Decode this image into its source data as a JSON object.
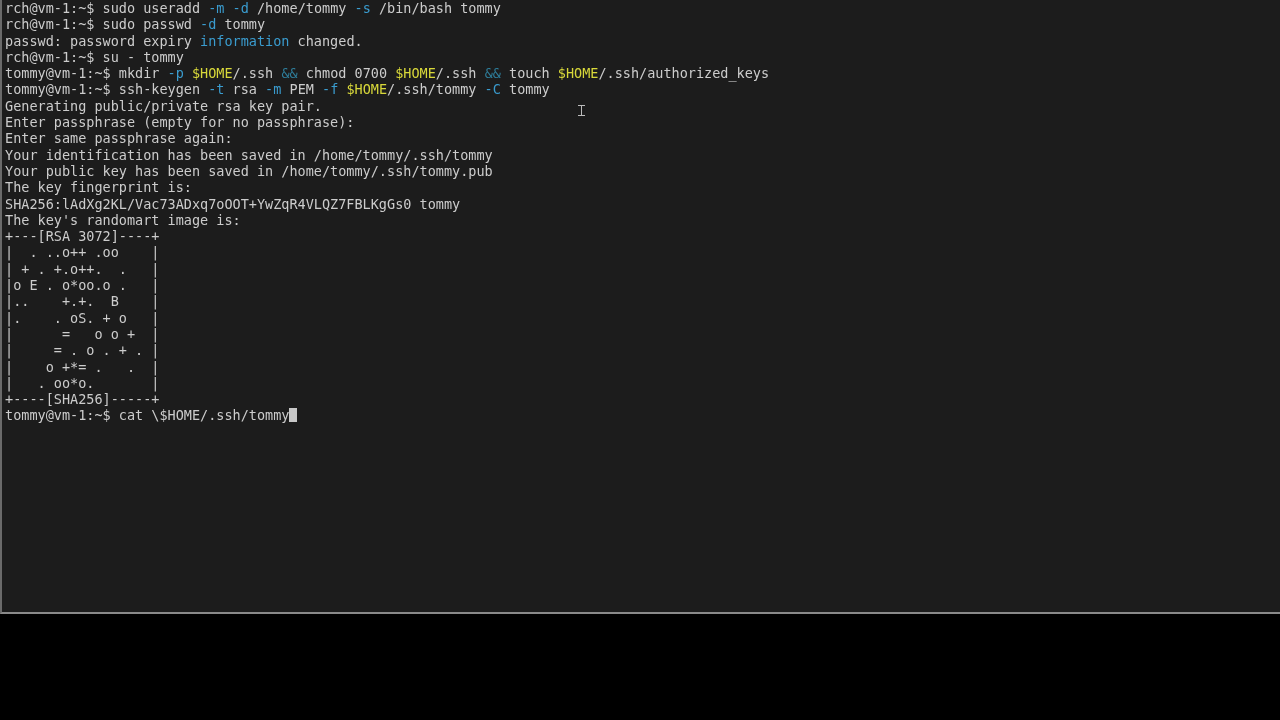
{
  "terminal": {
    "cursor": true,
    "lines": [
      {
        "segments": [
          {
            "kind": "plain",
            "text": "rch@vm-1:~$ sudo useradd "
          },
          {
            "kind": "flag",
            "text": "-m"
          },
          {
            "kind": "flag",
            "text": " -d"
          },
          {
            "kind": "plain",
            "text": " /home/tommy "
          },
          {
            "kind": "flag",
            "text": "-s"
          },
          {
            "kind": "plain",
            "text": " /bin/bash tommy"
          }
        ]
      },
      {
        "segments": [
          {
            "kind": "plain",
            "text": "rch@vm-1:~$ sudo passwd "
          },
          {
            "kind": "flag",
            "text": "-d"
          },
          {
            "kind": "plain",
            "text": " tommy"
          }
        ]
      },
      {
        "segments": [
          {
            "kind": "plain",
            "text": "passwd: password expiry "
          },
          {
            "kind": "flag",
            "text": "information"
          },
          {
            "kind": "plain",
            "text": " changed."
          }
        ]
      },
      {
        "segments": [
          {
            "kind": "plain",
            "text": "rch@vm-1:~$ su - tommy"
          }
        ]
      },
      {
        "segments": [
          {
            "kind": "plain",
            "text": "tommy@vm-1:~$ mkdir "
          },
          {
            "kind": "flag",
            "text": "-p"
          },
          {
            "kind": "var",
            "text": " $HOME"
          },
          {
            "kind": "plain",
            "text": "/.ssh "
          },
          {
            "kind": "op",
            "text": "&&"
          },
          {
            "kind": "plain",
            "text": " chmod 0700 "
          },
          {
            "kind": "var",
            "text": "$HOME"
          },
          {
            "kind": "plain",
            "text": "/.ssh "
          },
          {
            "kind": "op",
            "text": "&&"
          },
          {
            "kind": "plain",
            "text": " touch "
          },
          {
            "kind": "var",
            "text": "$HOME"
          },
          {
            "kind": "plain",
            "text": "/.ssh/authorized_keys"
          }
        ]
      },
      {
        "segments": [
          {
            "kind": "plain",
            "text": "tommy@vm-1:~$ ssh-keygen "
          },
          {
            "kind": "flag",
            "text": "-t"
          },
          {
            "kind": "plain",
            "text": " rsa "
          },
          {
            "kind": "flag",
            "text": "-m"
          },
          {
            "kind": "plain",
            "text": " PEM "
          },
          {
            "kind": "flag",
            "text": "-f"
          },
          {
            "kind": "var",
            "text": " $HOME"
          },
          {
            "kind": "plain",
            "text": "/.ssh/tommy "
          },
          {
            "kind": "flag",
            "text": "-C"
          },
          {
            "kind": "plain",
            "text": " tommy"
          }
        ]
      },
      {
        "segments": [
          {
            "kind": "plain",
            "text": "Generating public/private rsa key pair."
          }
        ]
      },
      {
        "segments": [
          {
            "kind": "plain",
            "text": "Enter passphrase (empty for no passphrase):"
          }
        ]
      },
      {
        "segments": [
          {
            "kind": "plain",
            "text": "Enter same passphrase again:"
          }
        ]
      },
      {
        "segments": [
          {
            "kind": "plain",
            "text": "Your identification has been saved in /home/tommy/.ssh/tommy"
          }
        ]
      },
      {
        "segments": [
          {
            "kind": "plain",
            "text": "Your public key has been saved in /home/tommy/.ssh/tommy.pub"
          }
        ]
      },
      {
        "segments": [
          {
            "kind": "plain",
            "text": "The key fingerprint is:"
          }
        ]
      },
      {
        "segments": [
          {
            "kind": "plain",
            "text": "SHA256:lAdXg2KL/Vac73ADxq7oOOT+YwZqR4VLQZ7FBLKgGs0 tommy"
          }
        ]
      },
      {
        "segments": [
          {
            "kind": "plain",
            "text": "The key's randomart image is:"
          }
        ]
      },
      {
        "segments": [
          {
            "kind": "plain",
            "text": "+---[RSA 3072]----+"
          }
        ]
      },
      {
        "segments": [
          {
            "kind": "plain",
            "text": "|  . ..o++ .oo    |"
          }
        ]
      },
      {
        "segments": [
          {
            "kind": "plain",
            "text": "| + . +.o++.  .   |"
          }
        ]
      },
      {
        "segments": [
          {
            "kind": "plain",
            "text": "|o E . o*oo.o .   |"
          }
        ]
      },
      {
        "segments": [
          {
            "kind": "plain",
            "text": "|..    +.+.  B    |"
          }
        ]
      },
      {
        "segments": [
          {
            "kind": "plain",
            "text": "|.    . oS. + o   |"
          }
        ]
      },
      {
        "segments": [
          {
            "kind": "plain",
            "text": "|      =   o o +  |"
          }
        ]
      },
      {
        "segments": [
          {
            "kind": "plain",
            "text": "|     = . o . + . |"
          }
        ]
      },
      {
        "segments": [
          {
            "kind": "plain",
            "text": "|    o +*= .   .  |"
          }
        ]
      },
      {
        "segments": [
          {
            "kind": "plain",
            "text": "|   . oo*o.       |"
          }
        ]
      },
      {
        "segments": [
          {
            "kind": "plain",
            "text": "+----[SHA256]-----+"
          }
        ]
      },
      {
        "segments": [
          {
            "kind": "plain",
            "text": "tommy@vm-1:~$ cat \\$HOME/.ssh/tommy"
          }
        ]
      }
    ]
  }
}
